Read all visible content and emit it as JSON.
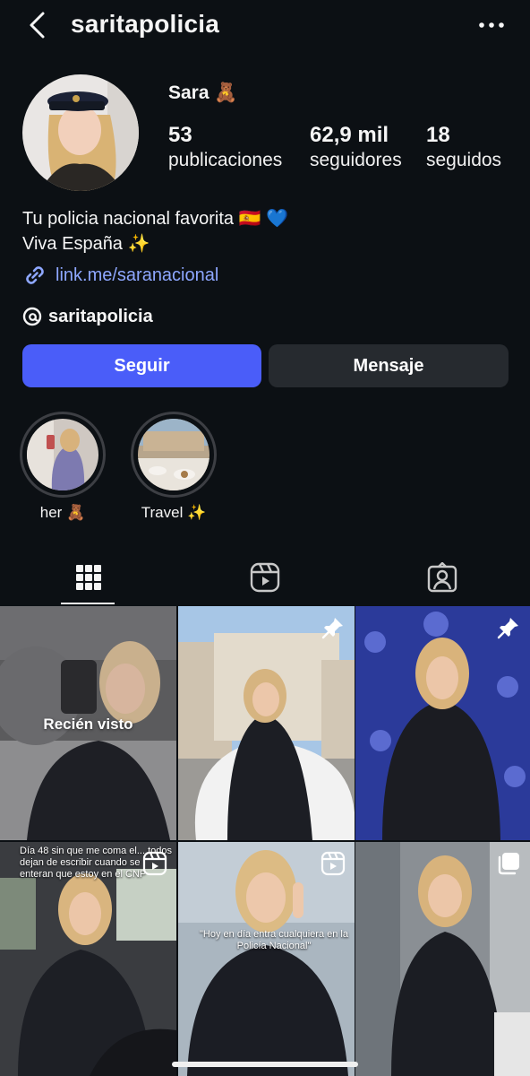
{
  "header": {
    "username": "saritapolicia",
    "back_icon": "chevron-left-icon",
    "more_icon": "more-horizontal-icon"
  },
  "profile": {
    "display_name": "Sara 🧸",
    "stats": [
      {
        "value": "53",
        "label": "publicaciones"
      },
      {
        "value": "62,9 mil",
        "label": "seguidores"
      },
      {
        "value": "18",
        "label": "seguidos"
      }
    ],
    "bio_lines": [
      "Tu policia nacional favorita 🇪🇸 💙",
      "Viva España ✨"
    ],
    "link": "link.me/saranacional",
    "threads_handle": "saritapolicia"
  },
  "actions": {
    "follow_label": "Seguir",
    "message_label": "Mensaje"
  },
  "highlights": [
    {
      "label": "her 🧸"
    },
    {
      "label": "Travel ✨"
    }
  ],
  "tabs": [
    {
      "name": "posts-grid",
      "icon": "grid-icon",
      "active": true
    },
    {
      "name": "reels",
      "icon": "reels-icon",
      "active": false
    },
    {
      "name": "tagged",
      "icon": "tagged-user-icon",
      "active": false
    }
  ],
  "posts": [
    {
      "overlay": "Recién visto",
      "icon": null
    },
    {
      "overlay": "",
      "icon": "pin-icon"
    },
    {
      "overlay": "",
      "icon": "pin-icon"
    },
    {
      "overlay": "",
      "icon": "reel-icon",
      "caption": "Día 48 sin que me coma el... todos dejan de escribir cuando se enteran que estoy en el CNP"
    },
    {
      "overlay": "",
      "icon": "reel-icon",
      "caption": "\"Hoy en día entra cualquiera en la Policía Nacional\""
    },
    {
      "overlay": "",
      "icon": "carousel-icon"
    }
  ],
  "colors": {
    "background": "#0c1014",
    "follow_button": "#4a5df9",
    "message_button": "#262a2f",
    "link": "#8ea7ff"
  }
}
